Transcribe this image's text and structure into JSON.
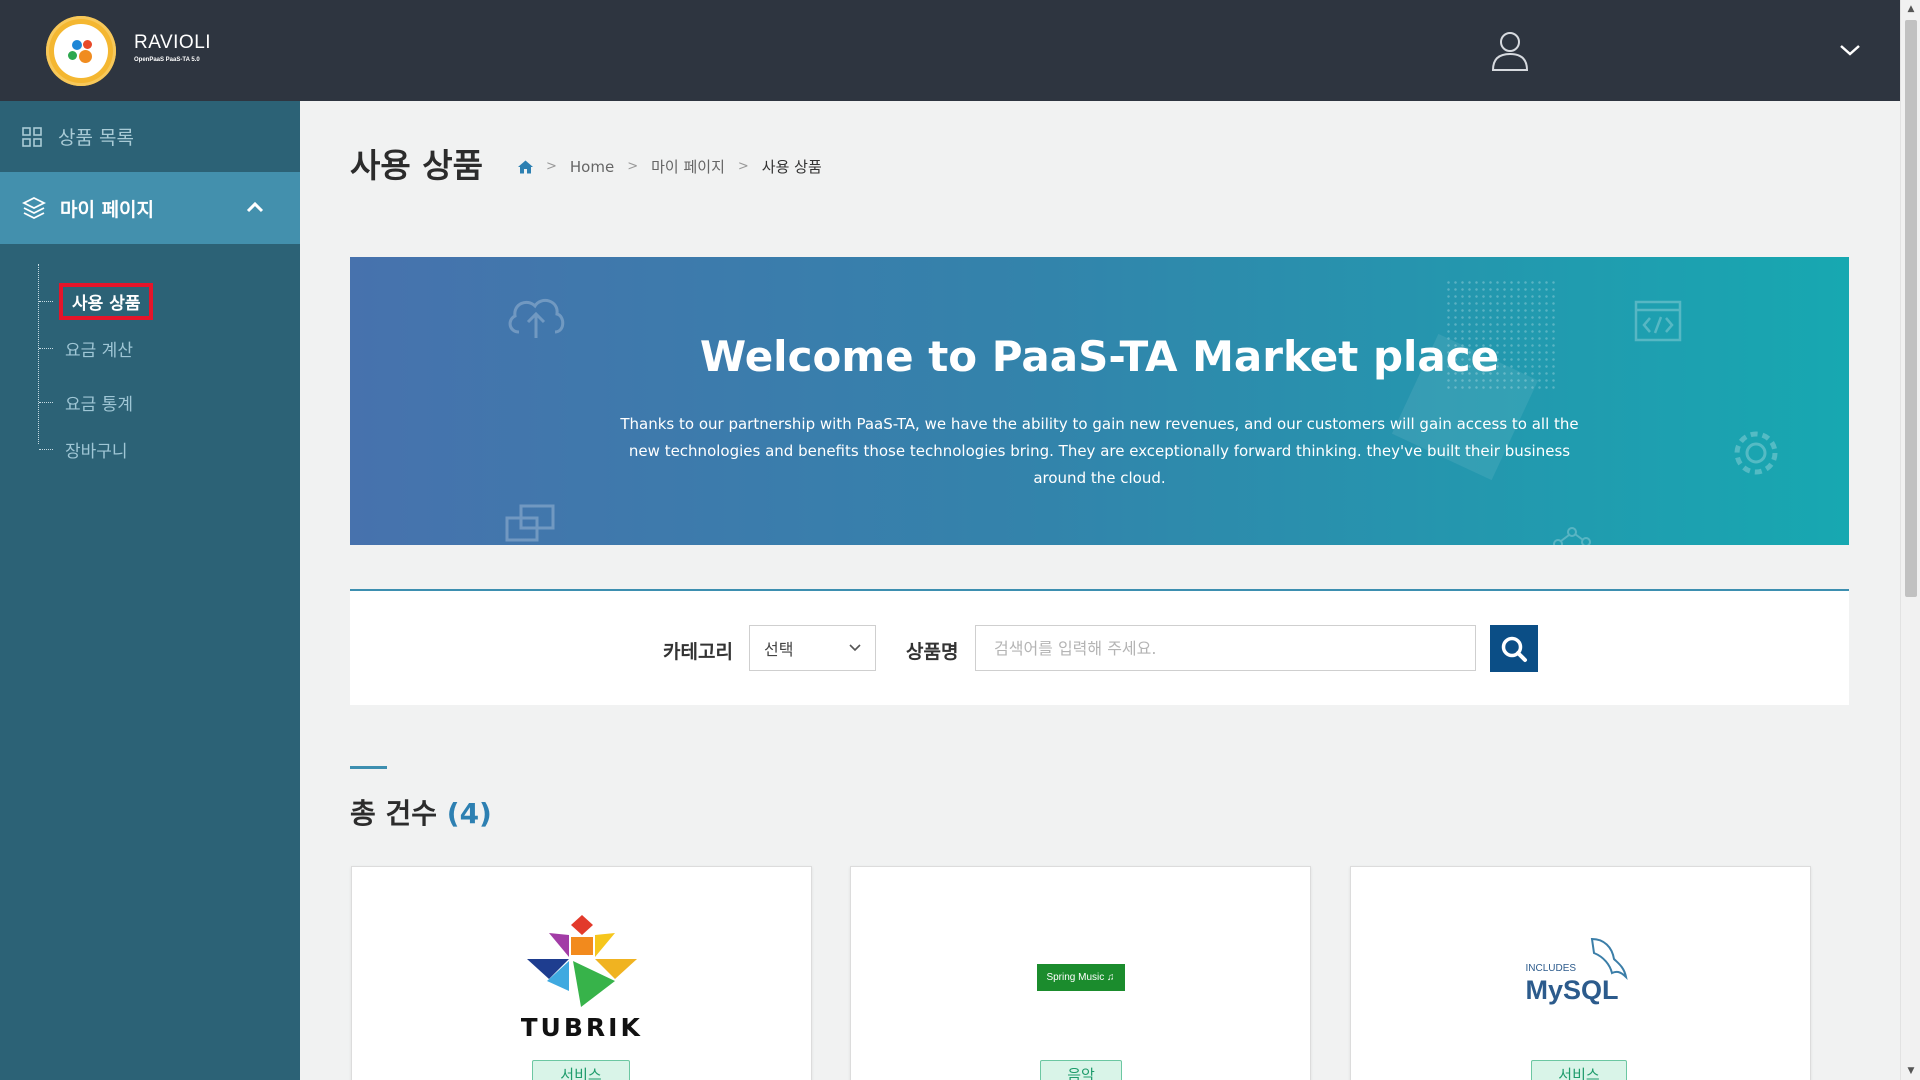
{
  "header": {
    "brand_name": "RAVIOLI",
    "brand_sub": "OpenPaaS PaaS-TA 5.0",
    "user_icon": "user-icon",
    "menu_toggle_icon": "chevron-down-icon"
  },
  "sidebar": {
    "catalog_label": "상품 목록",
    "mypage_label": "마이 페이지",
    "sub_items": [
      {
        "label": "사용 상품",
        "active": true
      },
      {
        "label": "요금 계산",
        "active": false
      },
      {
        "label": "요금 통계",
        "active": false
      },
      {
        "label": "장바구니",
        "active": false
      }
    ]
  },
  "page": {
    "title": "사용 상품",
    "breadcrumb": [
      "Home",
      "마이 페이지",
      "사용 상품"
    ]
  },
  "banner": {
    "title": "Welcome to PaaS-TA Market place",
    "text": "Thanks to our partnership with PaaS-TA, we have the ability to gain new revenues, and our customers will gain access to all the new technologies and benefits those technologies bring. They are exceptionally forward thinking. they've built their business around the cloud."
  },
  "search": {
    "category_label": "카테고리",
    "category_selected": "선택",
    "product_label": "상품명",
    "product_placeholder": "검색어를 입력해 주세요."
  },
  "results": {
    "count_label": "총 건수",
    "count_value": "(4)",
    "cards": [
      {
        "logo": "TUBRIK",
        "badge": "서비스"
      },
      {
        "logo": "Spring Music ♫",
        "badge": "음악"
      },
      {
        "logo_top": "INCLUDES",
        "logo": "MySQL",
        "badge": "서비스"
      }
    ]
  },
  "colors": {
    "header_bg": "#2e3540",
    "sidebar_bg": "#2c6276",
    "sidebar_active": "#4390ad",
    "search_button": "#0b4e86",
    "count_accent": "#2d80b2",
    "highlight_border": "#e5142a"
  }
}
